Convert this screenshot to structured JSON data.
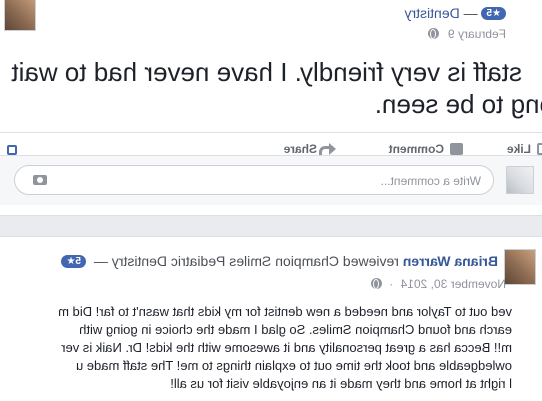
{
  "post1": {
    "page_name": "Dentistry",
    "separator": "—",
    "rating_badge": "5★",
    "date": "February 9",
    "text_line1": "staff is very friendly. I have never had to wait",
    "text_line2": "ong to be seen.",
    "actions": {
      "like": "Like",
      "comment": "Comment",
      "share": "Share"
    },
    "comment_placeholder": "Write a comment..."
  },
  "post2": {
    "reviewer": "Briana Warren",
    "reviewed_word": "reviewed",
    "page_name": "Champion Smiles Pediatric Dentistry",
    "separator": "—",
    "rating_badge": "5★",
    "date": "November 30, 2014",
    "review_lines": [
      "ved out to Taylor and needed a new dentist for my kids that wasn't to far! Did m",
      "earch and found Champion Smiles. So glad I made the choice in going with",
      "m!! Becca has a great personality and it awesome with the kids! Dr. Naik is ver",
      "owledgeable and took the time out to explain things to me! The staff made u",
      "l right at home and they made it an enjoyable visit for us all!"
    ]
  }
}
